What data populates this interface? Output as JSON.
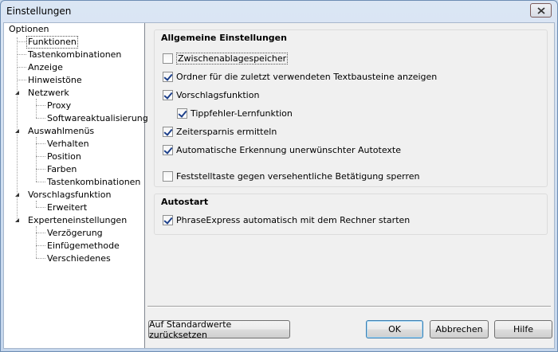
{
  "window": {
    "title": "Einstellungen"
  },
  "tree": {
    "items": [
      {
        "label": "Optionen"
      },
      {
        "label": "Funktionen"
      },
      {
        "label": "Tastenkombinationen"
      },
      {
        "label": "Anzeige"
      },
      {
        "label": "Hinweistöne"
      },
      {
        "label": "Netzwerk"
      },
      {
        "label": "Proxy"
      },
      {
        "label": "Softwareaktualisierung"
      },
      {
        "label": "Auswahlmenüs"
      },
      {
        "label": "Verhalten"
      },
      {
        "label": "Position"
      },
      {
        "label": "Farben"
      },
      {
        "label": "Tastenkombinationen"
      },
      {
        "label": "Vorschlagsfunktion"
      },
      {
        "label": "Erweitert"
      },
      {
        "label": "Experteneinstellungen"
      },
      {
        "label": "Verzögerung"
      },
      {
        "label": "Einfügemethode"
      },
      {
        "label": "Verschiedenes"
      }
    ],
    "selected_index": 1
  },
  "general": {
    "title": "Allgemeine Einstellungen",
    "options": [
      {
        "label": "Zwischenablagespeicher",
        "checked": false
      },
      {
        "label": "Ordner für die zuletzt verwendeten Textbausteine anzeigen",
        "checked": true
      },
      {
        "label": "Vorschlagsfunktion",
        "checked": true
      },
      {
        "label": "Tippfehler-Lernfunktion",
        "checked": true
      },
      {
        "label": "Zeitersparnis ermitteln",
        "checked": true
      },
      {
        "label": "Automatische Erkennung unerwünschter Autotexte",
        "checked": true
      },
      {
        "label": "Feststelltaste gegen versehentliche Betätigung sperren",
        "checked": false
      }
    ]
  },
  "autostart": {
    "title": "Autostart",
    "options": [
      {
        "label": "PhraseExpress automatisch mit dem Rechner starten",
        "checked": true
      }
    ]
  },
  "buttons": {
    "reset": "Auf Standardwerte zurücksetzen",
    "ok": "OK",
    "cancel": "Abbrechen",
    "help": "Hilfe"
  }
}
